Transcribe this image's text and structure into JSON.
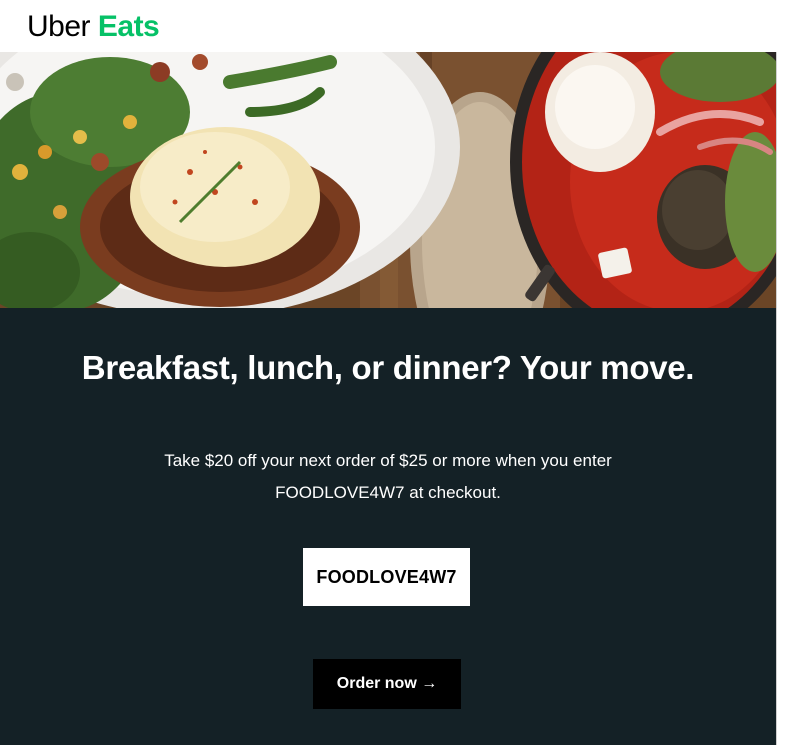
{
  "brand": {
    "name_part1": "Uber",
    "name_part2": "Eats",
    "primary_color": "#000000",
    "accent_color": "#06c167"
  },
  "hero": {
    "description": "food photo banner"
  },
  "content": {
    "background_color": "#142126",
    "headline": "Breakfast, lunch, or dinner? Your move.",
    "body": "Take $20 off your next order of $25 or more when you enter FOODLOVE4W7 at checkout.",
    "promo_code": "FOODLOVE4W7",
    "cta_label": "Order now →"
  }
}
